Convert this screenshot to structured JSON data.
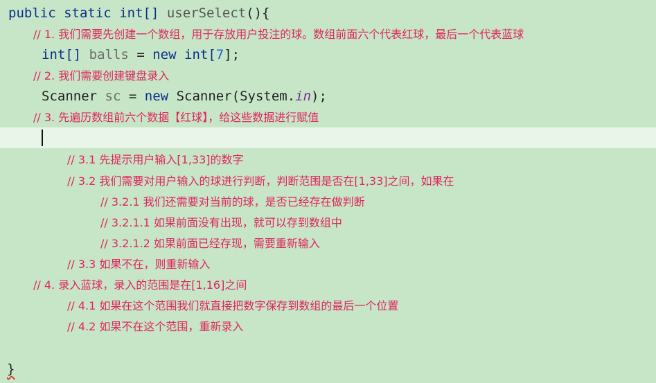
{
  "code": {
    "signature": {
      "kw_public": "public",
      "kw_static": "static",
      "type_int": "int[]",
      "method": "userSelect",
      "tail": "(){"
    },
    "c1": "// 1. 我们需要先创建一个数组，用于存放用户投注的球。数组前面六个代表红球，最后一个代表蓝球",
    "decl_balls": {
      "type": "int[]",
      "name": "balls",
      "eq": "=",
      "kw_new": "new",
      "type2": "int[",
      "size": "7",
      "end": "];"
    },
    "c2": "// 2. 我们需要创建键盘录入",
    "decl_sc": {
      "type": "Scanner",
      "name": "sc",
      "eq": "=",
      "kw_new": "new",
      "ctor": "Scanner(System.",
      "field": "in",
      "end": ");"
    },
    "c3": "// 3. 先遍历数组前六个数据【红球】，给这些数据进行赋值",
    "c3_1": "// 3.1 先提示用户输入[1,33]的数字",
    "c3_2": "// 3.2 我们需要对用户输入的球进行判断，判断范围是否在[1,33]之间，如果在",
    "c3_2_1": "// 3.2.1 我们还需要对当前的球，是否已经存在做判断",
    "c3_2_1_1": "// 3.2.1.1 如果前面没有出现，就可以存到数组中",
    "c3_2_1_2": "// 3.2.1.2 如果前面已经存现，需要重新输入",
    "c3_3": "// 3.3 如果不在，则重新输入",
    "c4": "// 4. 录入蓝球，录入的范围是在[1,16]之间",
    "c4_1": "// 4.1 如果在这个范围我们就直接把数字保存到数组的最后一个位置",
    "c4_2": "// 4.2 如果不在这个范围，重新录入",
    "closing": "}"
  },
  "colors": {
    "background": "#c7e6c7",
    "current_line": "#e8f5e8",
    "comment": "#e0245e",
    "keyword": "#0b2d8a",
    "number": "#1f5dd0"
  }
}
